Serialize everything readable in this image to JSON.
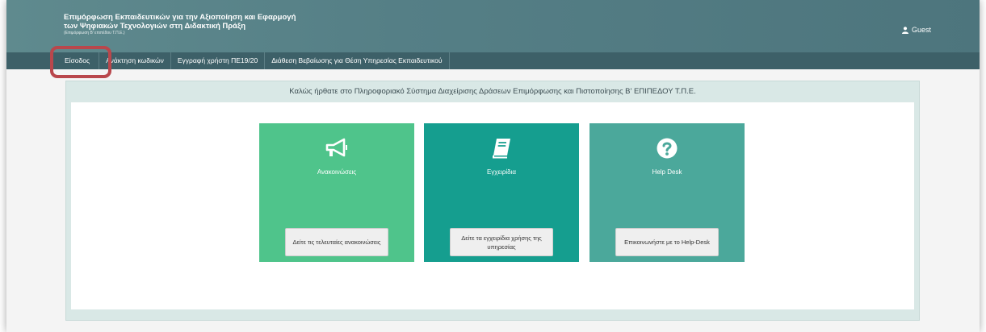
{
  "header": {
    "title_line1": "Επιμόρφωση Εκπαιδευτικών για την Αξιοποίηση και Εφαρμογή",
    "title_line2": "των Ψηφιακών Τεχνολογιών στη Διδακτική Πράξη",
    "subtitle": "(Επιμόρφωση Β' επιπέδου Τ.Π.Ε.)",
    "user_label": "Guest",
    "user_icon": "user-icon"
  },
  "nav": {
    "items": [
      {
        "label": "Είσοδος"
      },
      {
        "label": "Ανάκτηση κωδικών"
      },
      {
        "label": "Εγγραφή χρήστη ΠΕ19/20"
      },
      {
        "label": "Διάθεση Βεβαίωσης για Θέση Υπηρεσίας Εκπαιδευτικού"
      }
    ]
  },
  "welcome": "Καλώς ήρθατε στο Πληροφοριακό Σύστημα Διαχείρισης Δράσεων Επιμόρφωσης και Πιστοποίησης Β' ΕΠΙΠΕΔΟΥ Τ.Π.Ε.",
  "cards": [
    {
      "title": "Ανακοινώσεις",
      "button": "Δείτε τις τελευταίες ανακοινώσεις",
      "icon": "megaphone-icon",
      "color": "#4fc48b"
    },
    {
      "title": "Εγχειρίδια",
      "button": "Δείτε τα εγχειρίδια χρήσης της υπηρεσίας",
      "icon": "book-icon",
      "color": "#159e8f"
    },
    {
      "title": "Help Desk",
      "button": "Επικοινωνήστε με το Help-Desk",
      "icon": "question-circle-icon",
      "color": "#4ba89b"
    }
  ],
  "colors": {
    "header": "#557f86",
    "nav": "#3d6068",
    "highlight": "#b9474c",
    "panel": "#d9e8e6"
  }
}
